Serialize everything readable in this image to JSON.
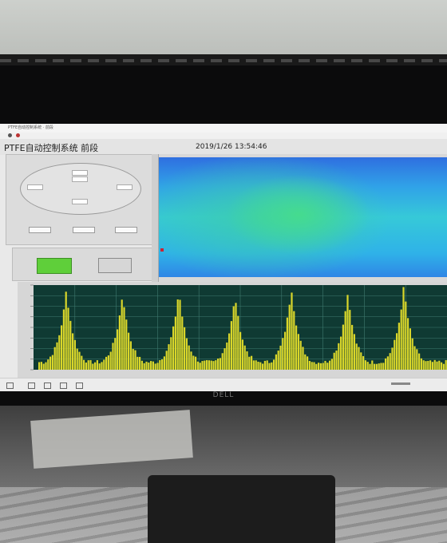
{
  "window": {
    "titlebar_text": "PTFE自动控制系统 · 前段"
  },
  "header": {
    "system_title": "PTFE自动控制系统    前段",
    "datetime": "2019/1/26 13:54:46"
  },
  "control_panel": {
    "fields": [
      {
        "label": "",
        "value": ""
      },
      {
        "label": "",
        "value": ""
      },
      {
        "label": "",
        "value": ""
      }
    ],
    "ellipse_fields": [
      {
        "label": ""
      },
      {
        "label": ""
      },
      {
        "label": ""
      },
      {
        "label": ""
      },
      {
        "label": ""
      }
    ]
  },
  "buttons": {
    "start_label": "",
    "stop_label": ""
  },
  "brand": {
    "logo": "DELL"
  },
  "colors": {
    "heat_low": "#2f6fe0",
    "heat_mid": "#36c9d8",
    "heat_high": "#46dc8c",
    "spectrum_bars": "#d9d62a",
    "chart_bg": "#0f3a33",
    "grid": "#3f7b70",
    "start_button": "#5fcf3a"
  },
  "chart_data": {
    "type": "bar",
    "title": "",
    "xlabel": "",
    "ylabel": "",
    "grid": true,
    "peaks": [
      0.92,
      0.88,
      0.92,
      0.85,
      0.95,
      0.88,
      0.97
    ],
    "baseline": 0.06
  }
}
